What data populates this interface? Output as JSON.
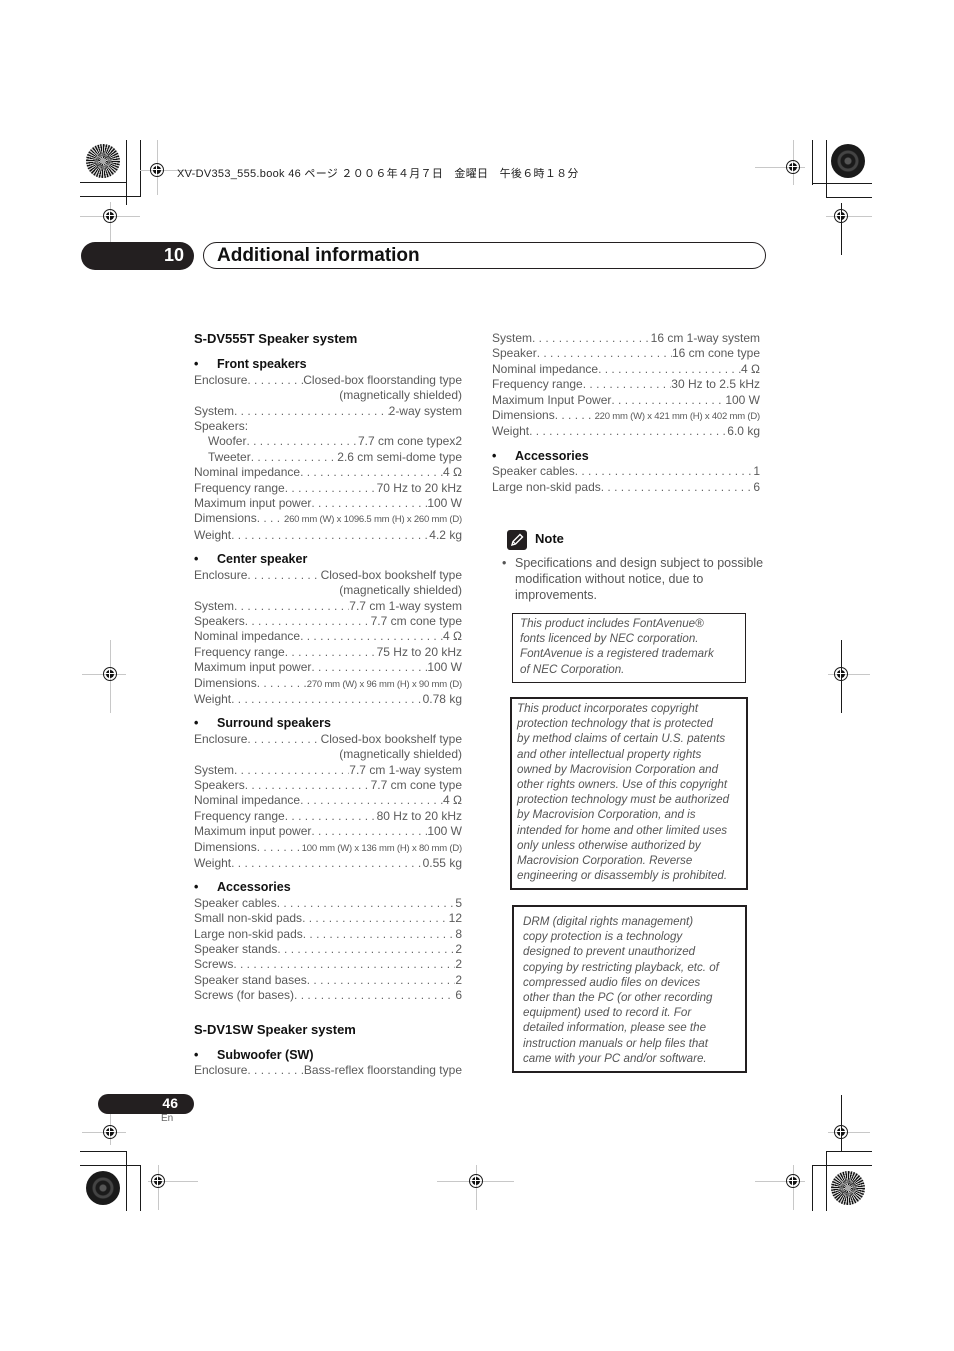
{
  "job_line": "XV-DV353_555.book  46 ページ  ２００６年４月７日　金曜日　午後６時１８分",
  "chapter": {
    "number": "10",
    "title": "Additional information"
  },
  "left_column": {
    "system_title": "S-DV555T Speaker system",
    "front": {
      "heading": "Front speakers",
      "rows": [
        {
          "k": "Enclosure",
          "v": "Closed-box floorstanding type"
        },
        {
          "cont": "(magnetically shielded)"
        },
        {
          "k": "System",
          "v": "2-way system"
        },
        {
          "k": "Speakers:",
          "v": ""
        },
        {
          "k": "Woofer",
          "v": "7.7 cm cone typex2",
          "indent": true
        },
        {
          "k": "Tweeter",
          "v": "2.6 cm semi-dome type",
          "indent": true
        },
        {
          "k": "Nominal impedance",
          "v": "4 Ω"
        },
        {
          "k": "Frequency range",
          "v": "70 Hz to 20 kHz"
        },
        {
          "k": "Maximum input power",
          "v": "100 W"
        },
        {
          "k": "Dimensions",
          "v": "260 mm (W) x 1096.5 mm (H) x 260 mm (D)",
          "small": true
        },
        {
          "k": "Weight",
          "v": "4.2 kg"
        }
      ]
    },
    "center": {
      "heading": "Center speaker",
      "rows": [
        {
          "k": "Enclosure",
          "v": "Closed-box bookshelf type"
        },
        {
          "cont": "(magnetically shielded)"
        },
        {
          "k": "System",
          "v": "7.7 cm 1-way system"
        },
        {
          "k": "Speakers",
          "v": "7.7 cm cone type"
        },
        {
          "k": "Nominal impedance",
          "v": "4 Ω"
        },
        {
          "k": "Frequency range",
          "v": "75 Hz to 20 kHz"
        },
        {
          "k": "Maximum input power",
          "v": "100 W"
        },
        {
          "k": "Dimensions",
          "v": "270 mm (W) x 96 mm (H) x 90 mm (D)",
          "small": true
        },
        {
          "k": "Weight",
          "v": "0.78 kg"
        }
      ]
    },
    "surround": {
      "heading": "Surround speakers",
      "rows": [
        {
          "k": "Enclosure",
          "v": "Closed-box bookshelf type"
        },
        {
          "cont": "(magnetically shielded)"
        },
        {
          "k": "System",
          "v": "7.7 cm 1-way system"
        },
        {
          "k": "Speakers",
          "v": "7.7 cm cone type"
        },
        {
          "k": "Nominal impedance",
          "v": "4 Ω"
        },
        {
          "k": "Frequency range",
          "v": "80 Hz to 20 kHz"
        },
        {
          "k": "Maximum input power",
          "v": "100 W"
        },
        {
          "k": "Dimensions",
          "v": "100 mm (W) x 136 mm (H) x 80 mm (D)",
          "small": true
        },
        {
          "k": "Weight",
          "v": "0.55 kg"
        }
      ]
    },
    "accessories": {
      "heading": "Accessories",
      "rows": [
        {
          "k": "Speaker cables",
          "v": "5"
        },
        {
          "k": "Small non-skid pads",
          "v": "12"
        },
        {
          "k": "Large non-skid pads",
          "v": "8"
        },
        {
          "k": "Speaker stands",
          "v": "2"
        },
        {
          "k": "Screws",
          "v": "2"
        },
        {
          "k": "Speaker stand bases",
          "v": "2"
        },
        {
          "k": "Screws (for bases)",
          "v": "6"
        }
      ]
    },
    "sw_system_title": "S-DV1SW Speaker system",
    "subwoofer": {
      "heading": "Subwoofer (SW)",
      "rows": [
        {
          "k": "Enclosure",
          "v": "Bass-reflex floorstanding type"
        }
      ]
    }
  },
  "right_column": {
    "subwoofer_rows": [
      {
        "k": "System",
        "v": "16 cm 1-way system"
      },
      {
        "k": "Speaker",
        "v": "16 cm cone type"
      },
      {
        "k": "Nominal impedance",
        "v": "4 Ω"
      },
      {
        "k": "Frequency range",
        "v": "30 Hz to 2.5 kHz"
      },
      {
        "k": "Maximum Input Power",
        "v": "100 W"
      },
      {
        "k": "Dimensions",
        "v": "220 mm (W) x 421 mm (H) x 402 mm (D)",
        "small": true
      },
      {
        "k": "Weight",
        "v": "6.0 kg"
      }
    ],
    "accessories": {
      "heading": "Accessories",
      "rows": [
        {
          "k": "Speaker cables",
          "v": "1"
        },
        {
          "k": "Large non-skid pads",
          "v": "6"
        }
      ]
    }
  },
  "note": {
    "title": "Note",
    "icon": "pencil-icon",
    "items": [
      "Specifications and design subject to possible modification without notice, due to improvements."
    ]
  },
  "boxes": {
    "fontavenue": [
      "This product includes FontAvenue®",
      "fonts licenced by NEC corporation.",
      "FontAvenue is a registered trademark",
      "of NEC Corporation."
    ],
    "macrovision": [
      "This product incorporates copyright",
      "protection technology that is protected",
      "by method claims of certain U.S. patents",
      "and other intellectual property rights",
      "owned by Macrovision Corporation and",
      "other rights owners. Use of this copyright",
      "protection technology must be authorized",
      "by Macrovision Corporation, and is",
      "intended for home and other limited uses",
      "only unless otherwise authorized by",
      "Macrovision Corporation. Reverse",
      "engineering or disassembly is prohibited."
    ],
    "drm": [
      "DRM (digital rights management)",
      "copy protection is a technology",
      "designed to prevent unauthorized",
      "copying by restricting playback, etc. of",
      "compressed audio files on devices",
      "other than the PC (or other recording",
      "equipment) used to record it. For",
      "detailed information, please see the",
      "instruction manuals or help files that",
      "came with your PC and/or software."
    ]
  },
  "footer": {
    "page_number": "46",
    "language": "En"
  },
  "colors": {
    "dark": "#231f20",
    "body_text": "#5a5a5a",
    "heading": "#111111"
  }
}
